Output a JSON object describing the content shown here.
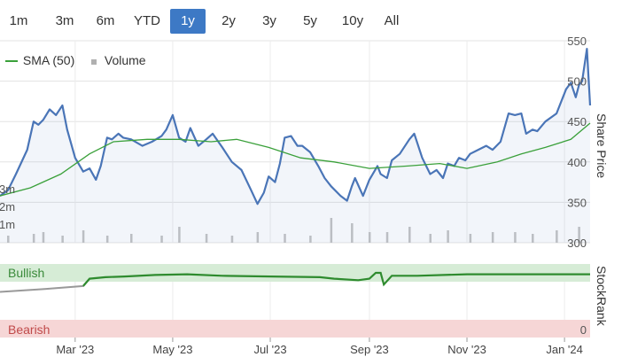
{
  "range_buttons": [
    "1m",
    "3m",
    "6m",
    "YTD",
    "1y",
    "2y",
    "3y",
    "5y",
    "10y",
    "All"
  ],
  "active_range": "1y",
  "legend": {
    "sma_label": "SMA (50)",
    "volume_label": "Volume"
  },
  "colors": {
    "price": "#4a75b7",
    "sma": "#3aa03a",
    "stockrank": "#2e8b2e",
    "stockrank_low": "#999999",
    "bullish_band": "#d6ecd6",
    "bearish_band": "#f6d6d6",
    "active_button": "#3d79c5"
  },
  "chart_data": [
    {
      "type": "line",
      "title": "",
      "xlabel": "",
      "ylabel": "Share Price",
      "ylim": [
        300,
        550
      ],
      "yticks": [
        300,
        350,
        400,
        450,
        500,
        550
      ],
      "volume_ticks": [
        "1m",
        "2m",
        "3m"
      ],
      "x_ticks": [
        "Mar '23",
        "May '23",
        "Jul '23",
        "Sep '23",
        "Nov '23",
        "Jan '24"
      ],
      "x_tick_dates": [
        "2023-03-01",
        "2023-05-01",
        "2023-07-01",
        "2023-09-01",
        "2023-11-01",
        "2024-01-01"
      ],
      "x_range": [
        "2023-01-13",
        "2024-01-17"
      ],
      "grid": true,
      "legend_position": "top-left",
      "series": [
        {
          "name": "Share Price",
          "x": [
            "2023-01-13",
            "2023-01-18",
            "2023-01-23",
            "2023-01-30",
            "2023-02-03",
            "2023-02-06",
            "2023-02-09",
            "2023-02-13",
            "2023-02-17",
            "2023-02-21",
            "2023-02-24",
            "2023-03-01",
            "2023-03-06",
            "2023-03-10",
            "2023-03-14",
            "2023-03-17",
            "2023-03-21",
            "2023-03-24",
            "2023-03-28",
            "2023-03-31",
            "2023-04-05",
            "2023-04-12",
            "2023-04-18",
            "2023-04-24",
            "2023-04-27",
            "2023-05-01",
            "2023-05-03",
            "2023-05-05",
            "2023-05-09",
            "2023-05-12",
            "2023-05-17",
            "2023-05-22",
            "2023-05-26",
            "2023-06-01",
            "2023-06-07",
            "2023-06-13",
            "2023-06-19",
            "2023-06-23",
            "2023-06-27",
            "2023-06-30",
            "2023-07-04",
            "2023-07-07",
            "2023-07-10",
            "2023-07-14",
            "2023-07-18",
            "2023-07-21",
            "2023-07-26",
            "2023-07-31",
            "2023-08-04",
            "2023-08-08",
            "2023-08-14",
            "2023-08-18",
            "2023-08-21",
            "2023-08-23",
            "2023-08-28",
            "2023-09-01",
            "2023-09-06",
            "2023-09-08",
            "2023-09-12",
            "2023-09-15",
            "2023-09-20",
            "2023-09-26",
            "2023-09-29",
            "2023-10-04",
            "2023-10-09",
            "2023-10-13",
            "2023-10-17",
            "2023-10-20",
            "2023-10-24",
            "2023-10-27",
            "2023-10-31",
            "2023-11-03",
            "2023-11-08",
            "2023-11-13",
            "2023-11-17",
            "2023-11-22",
            "2023-11-27",
            "2023-12-01",
            "2023-12-05",
            "2023-12-08",
            "2023-12-12",
            "2023-12-15",
            "2023-12-20",
            "2023-12-27",
            "2024-01-02",
            "2024-01-05",
            "2024-01-08",
            "2024-01-10",
            "2024-01-12",
            "2024-01-15",
            "2024-01-17"
          ],
          "y": [
            358,
            365,
            385,
            415,
            450,
            446,
            452,
            465,
            458,
            470,
            440,
            405,
            388,
            392,
            378,
            395,
            430,
            428,
            435,
            430,
            428,
            420,
            425,
            432,
            440,
            458,
            444,
            430,
            425,
            442,
            420,
            428,
            435,
            418,
            400,
            390,
            365,
            348,
            362,
            382,
            375,
            398,
            430,
            432,
            420,
            420,
            412,
            395,
            380,
            370,
            358,
            352,
            370,
            380,
            358,
            378,
            395,
            385,
            380,
            402,
            410,
            428,
            435,
            405,
            385,
            390,
            380,
            398,
            395,
            405,
            402,
            410,
            415,
            420,
            415,
            425,
            460,
            458,
            460,
            435,
            440,
            438,
            450,
            460,
            490,
            498,
            480,
            495,
            500,
            540,
            470
          ]
        },
        {
          "name": "SMA (50)",
          "x": [
            "2023-01-13",
            "2023-02-01",
            "2023-02-20",
            "2023-03-10",
            "2023-03-25",
            "2023-04-15",
            "2023-05-05",
            "2023-05-25",
            "2023-06-10",
            "2023-06-30",
            "2023-07-20",
            "2023-08-10",
            "2023-09-01",
            "2023-09-25",
            "2023-10-15",
            "2023-11-01",
            "2023-11-20",
            "2023-12-05",
            "2023-12-20",
            "2024-01-05",
            "2024-01-17"
          ],
          "y": [
            358,
            368,
            385,
            410,
            425,
            428,
            428,
            425,
            428,
            418,
            405,
            400,
            392,
            395,
            398,
            392,
            400,
            410,
            418,
            428,
            448
          ]
        }
      ],
      "volume": {
        "x": [
          "2023-01-18",
          "2023-02-03",
          "2023-02-09",
          "2023-02-21",
          "2023-03-06",
          "2023-03-21",
          "2023-04-05",
          "2023-04-24",
          "2023-05-05",
          "2023-05-22",
          "2023-06-07",
          "2023-06-23",
          "2023-07-10",
          "2023-07-26",
          "2023-08-08",
          "2023-08-21",
          "2023-09-01",
          "2023-09-12",
          "2023-09-26",
          "2023-10-09",
          "2023-10-20",
          "2023-11-03",
          "2023-11-17",
          "2023-12-01",
          "2023-12-12",
          "2023-12-27",
          "2024-01-10"
        ],
        "y": [
          0.4,
          0.5,
          0.6,
          0.4,
          0.7,
          0.4,
          0.5,
          0.4,
          0.9,
          0.5,
          0.4,
          0.6,
          0.5,
          0.4,
          1.4,
          1.1,
          0.6,
          0.6,
          0.9,
          0.5,
          0.7,
          0.5,
          0.6,
          0.6,
          0.5,
          0.7,
          0.9
        ]
      }
    },
    {
      "type": "line",
      "title": "",
      "xlabel": "",
      "ylabel": "StockRank",
      "ylim": [
        0,
        100
      ],
      "yticks": [
        0
      ],
      "bands": [
        "Bullish",
        "Bearish"
      ],
      "series": [
        {
          "name": "StockRank",
          "x": [
            "2023-01-13",
            "2023-02-10",
            "2023-03-06",
            "2023-03-10",
            "2023-03-20",
            "2023-04-01",
            "2023-04-20",
            "2023-05-10",
            "2023-06-01",
            "2023-07-01",
            "2023-08-01",
            "2023-08-10",
            "2023-08-25",
            "2023-09-01",
            "2023-09-05",
            "2023-09-08",
            "2023-09-10",
            "2023-09-15",
            "2023-10-01",
            "2023-11-01",
            "2023-12-01",
            "2024-01-01",
            "2024-01-17"
          ],
          "y": [
            62,
            66,
            70,
            80,
            82,
            83,
            85,
            86,
            84,
            83,
            82,
            80,
            78,
            80,
            88,
            88,
            72,
            84,
            84,
            86,
            86,
            86,
            86
          ]
        }
      ]
    }
  ]
}
